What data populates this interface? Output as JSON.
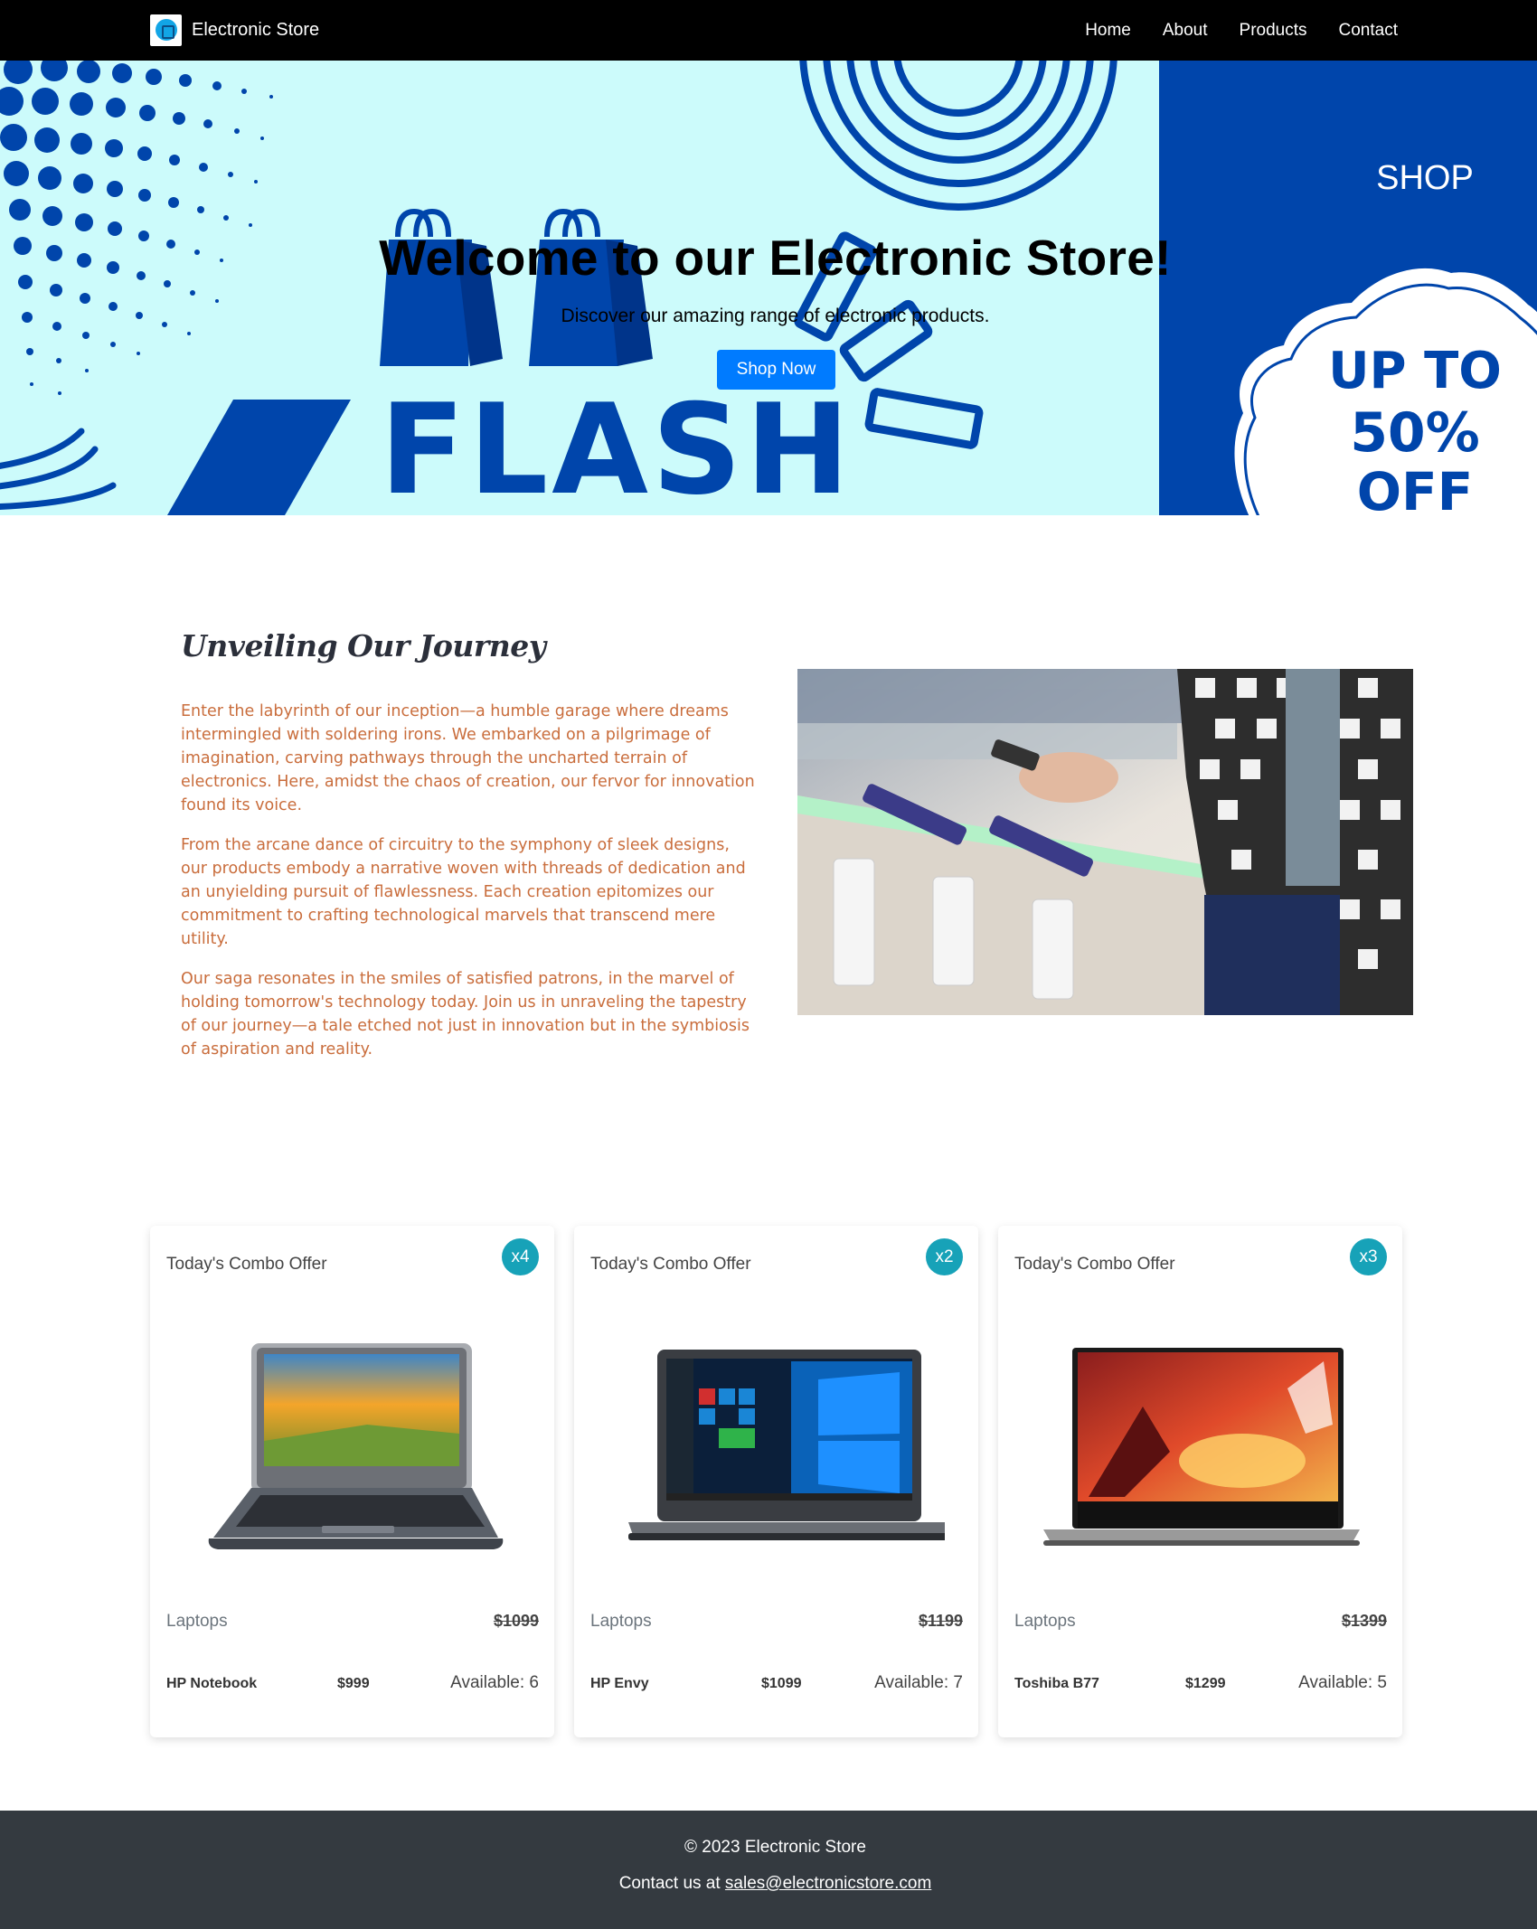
{
  "navbar": {
    "brand": "Electronic Store",
    "links": [
      "Home",
      "About",
      "Products",
      "Contact"
    ]
  },
  "hero": {
    "title": "Welcome to our Electronic Store!",
    "subtitle": "Discover our amazing range of electronic products.",
    "button": "Shop Now",
    "banner": {
      "word": "FLASH",
      "shop": "SHOP",
      "offer_line1": "UP TO",
      "offer_line2": "50%",
      "offer_line3": "OFF",
      "bg_color": "#ccfbfb",
      "accent_color": "#0045ab"
    }
  },
  "about": {
    "title": "Unveiling Our Journey",
    "paragraphs": [
      "Enter the labyrinth of our inception—a humble garage where dreams intermingled with soldering irons. We embarked on a pilgrimage of imagination, carving pathways through the uncharted terrain of electronics. Here, amidst the chaos of creation, our fervor for innovation found its voice.",
      "From the arcane dance of circuitry to the symphony of sleek designs, our products embody a narrative woven with threads of dedication and an unyielding pursuit of flawlessness. Each creation epitomizes our commitment to crafting technological marvels that transcend mere utility.",
      "Our saga resonates in the smiles of satisfied patrons, in the marvel of holding tomorrow's technology today. Join us in unraveling the tapestry of our journey—a tale etched not just in innovation but in the symbiosis of aspiration and reality."
    ],
    "text_color": "#c96d3c"
  },
  "products": [
    {
      "title": "Today's Combo Offer",
      "badge": "x4",
      "category": "Laptops",
      "old_price": "$1099",
      "name": "HP Notebook",
      "price": "$999",
      "available": "Available: 6"
    },
    {
      "title": "Today's Combo Offer",
      "badge": "x2",
      "category": "Laptops",
      "old_price": "$1199",
      "name": "HP Envy",
      "price": "$1099",
      "available": "Available: 7"
    },
    {
      "title": "Today's Combo Offer",
      "badge": "x3",
      "category": "Laptops",
      "old_price": "$1399",
      "name": "Toshiba B77",
      "price": "$1299",
      "available": "Available: 5"
    }
  ],
  "footer": {
    "copyright": "© 2023 Electronic Store",
    "contact_prefix": "Contact us at",
    "email": "sales@electronicstore.com"
  },
  "colors": {
    "navbar_bg": "#000000",
    "primary_button": "#007bff",
    "badge": "#17a2b8",
    "footer_bg": "#343a40"
  }
}
